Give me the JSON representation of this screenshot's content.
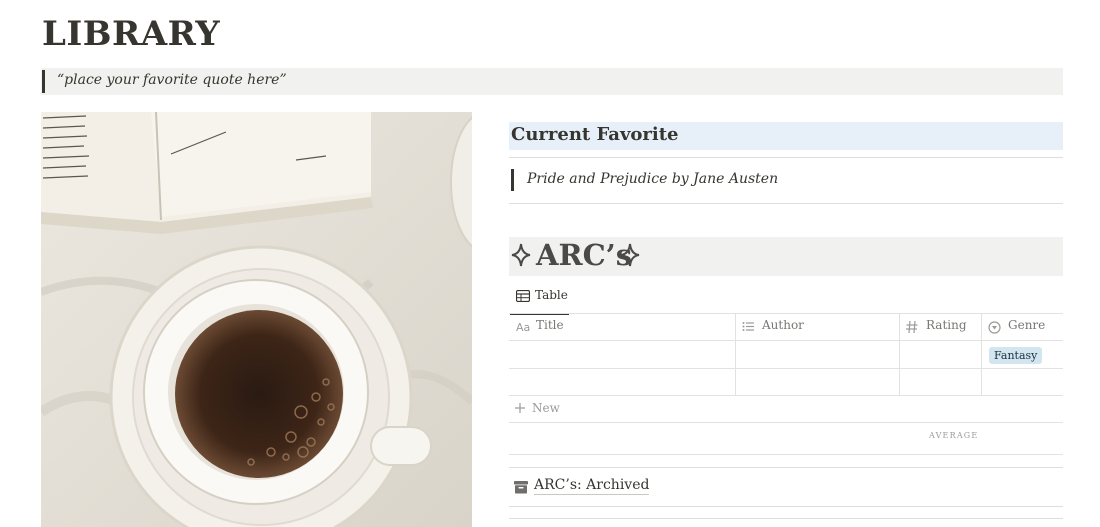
{
  "page": {
    "title": "LIBRARY",
    "quote": "“place your favorite quote here”"
  },
  "current_favorite": {
    "heading": "Current Favorite",
    "book": "Pride and Prejudice by Jane Austen"
  },
  "arcs": {
    "heading": "ARC’s",
    "view_tab": "Table",
    "columns": [
      {
        "label": "Title",
        "icon": "text-property-icon"
      },
      {
        "label": "Author",
        "icon": "list-property-icon"
      },
      {
        "label": "Rating",
        "icon": "number-property-icon"
      },
      {
        "label": "Genre",
        "icon": "select-property-icon"
      }
    ],
    "rows": [
      {
        "title": "",
        "author": "",
        "rating": "",
        "genre": "Fantasy"
      },
      {
        "title": "",
        "author": "",
        "rating": "",
        "genre": ""
      }
    ],
    "new_label": "New",
    "average_label": "AVERAGE"
  },
  "archived": {
    "label": "ARC’s: Archived",
    "icon": "archive-icon"
  },
  "colors": {
    "favorite_bg": "#e7f0f8",
    "quote_bg": "#f1f1ef",
    "genre_tag_bg": "#d3e5ef"
  }
}
